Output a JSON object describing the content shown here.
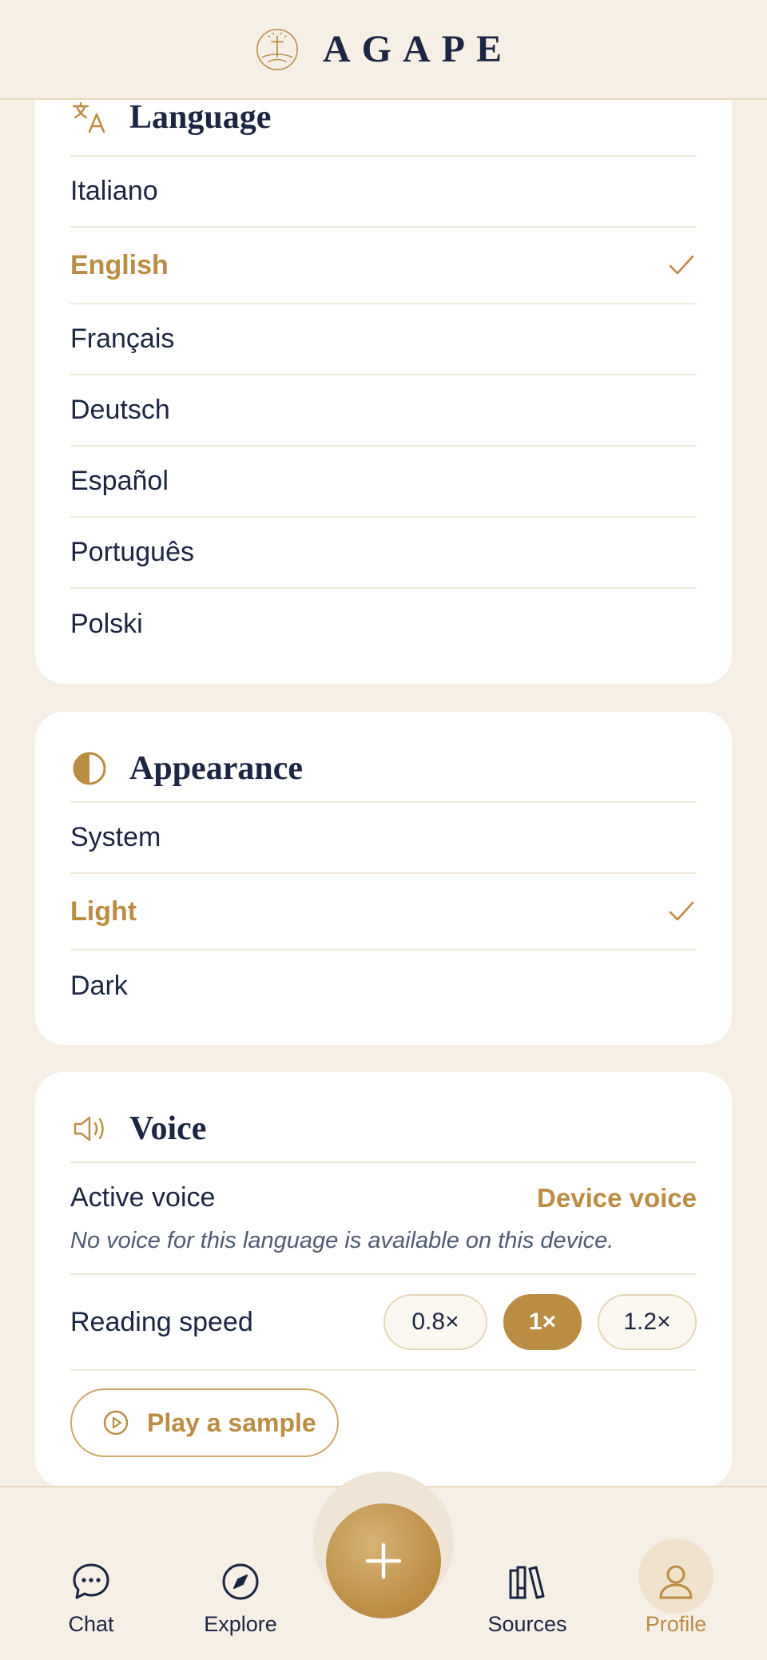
{
  "header": {
    "brand": "AGAPE",
    "logo_icon": "cross-sunrise-logo"
  },
  "language": {
    "title": "Language",
    "icon": "translate-icon",
    "options": [
      "Italiano",
      "English",
      "Français",
      "Deutsch",
      "Español",
      "Português",
      "Polski"
    ],
    "selected": "English"
  },
  "appearance": {
    "title": "Appearance",
    "icon": "contrast-icon",
    "options": [
      "System",
      "Light",
      "Dark"
    ],
    "selected": "Light"
  },
  "voice": {
    "title": "Voice",
    "icon": "speaker-icon",
    "active_label": "Active voice",
    "active_value": "Device voice",
    "note": "No voice for this language is available on this device.",
    "speed_label": "Reading speed",
    "speeds": [
      "0.8×",
      "1×",
      "1.2×"
    ],
    "selected_speed": "1×",
    "sample_label": "Play a sample"
  },
  "nav": {
    "chat": "Chat",
    "explore": "Explore",
    "sources": "Sources",
    "profile": "Profile",
    "active": "Profile"
  },
  "colors": {
    "accent": "#bb8c43",
    "navy": "#1c2541",
    "background": "#f5efe6",
    "card": "#ffffff"
  }
}
